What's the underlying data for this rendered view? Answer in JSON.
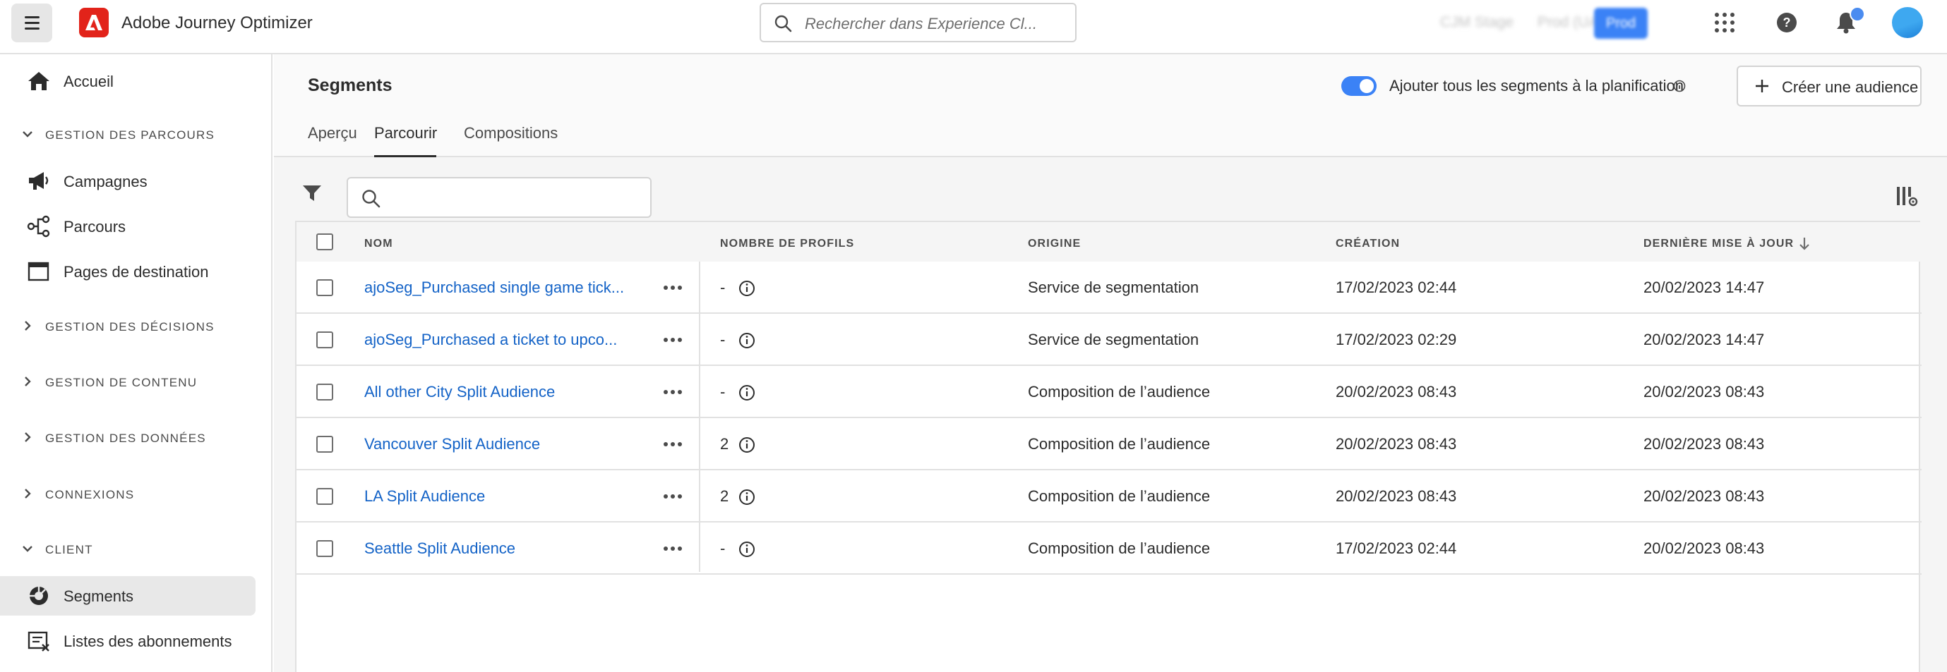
{
  "app": {
    "title": "Adobe Journey Optimizer",
    "search_placeholder": "Rechercher dans Experience Cl...",
    "org_label": "CJM Stage",
    "sandbox_label": "Prod (UAT)",
    "env_badge": "Prod",
    "brand_color": "#e2231a",
    "accent_color": "#3b82f6"
  },
  "sidebar": {
    "home": "Accueil",
    "sections": [
      {
        "label": "GESTION DES PARCOURS",
        "expanded": true
      },
      {
        "label": "GESTION DES DÉCISIONS",
        "expanded": false
      },
      {
        "label": "GESTION DE CONTENU",
        "expanded": false
      },
      {
        "label": "GESTION DES DONNÉES",
        "expanded": false
      },
      {
        "label": "CONNEXIONS",
        "expanded": false
      },
      {
        "label": "CLIENT",
        "expanded": true
      }
    ],
    "journey_items": [
      "Campagnes",
      "Parcours",
      "Pages de destination"
    ],
    "client_items": [
      "Segments",
      "Listes des abonnements"
    ]
  },
  "header": {
    "page_title": "Segments",
    "tabs": [
      "Aperçu",
      "Parcourir",
      "Compositions"
    ],
    "active_tab": "Parcourir",
    "toggle_label": "Ajouter tous les segments à la planification",
    "toggle_on": true,
    "create_button": "Créer une audience"
  },
  "table": {
    "columns": [
      "NOM",
      "NOMBRE DE PROFILS",
      "ORIGINE",
      "CRÉATION",
      "DERNIÈRE MISE À JOUR"
    ],
    "sort_column": "DERNIÈRE MISE À JOUR",
    "sort_direction": "descending",
    "rows": [
      {
        "name": "ajoSeg_Purchased single game tick...",
        "profiles": "-",
        "origin": "Service de segmentation",
        "created": "17/02/2023 02:44",
        "updated": "20/02/2023 14:47"
      },
      {
        "name": "ajoSeg_Purchased a ticket to upco...",
        "profiles": "-",
        "origin": "Service de segmentation",
        "created": "17/02/2023 02:29",
        "updated": "20/02/2023 14:47"
      },
      {
        "name": "All other City Split Audience",
        "profiles": "-",
        "origin": "Composition de l’audience",
        "created": "20/02/2023 08:43",
        "updated": "20/02/2023 08:43"
      },
      {
        "name": "Vancouver Split Audience",
        "profiles": "2",
        "origin": "Composition de l’audience",
        "created": "20/02/2023 08:43",
        "updated": "20/02/2023 08:43"
      },
      {
        "name": "LA Split Audience",
        "profiles": "2",
        "origin": "Composition de l’audience",
        "created": "20/02/2023 08:43",
        "updated": "20/02/2023 08:43"
      },
      {
        "name": "Seattle Split Audience",
        "profiles": "-",
        "origin": "Composition de l’audience",
        "created": "17/02/2023 02:44",
        "updated": "20/02/2023 08:43"
      }
    ]
  }
}
